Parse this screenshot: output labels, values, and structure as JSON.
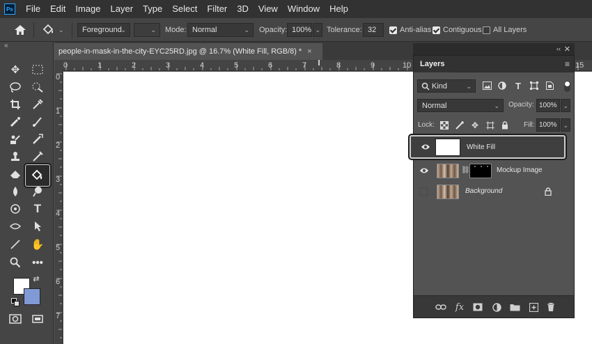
{
  "app": {
    "logo_text": "Ps"
  },
  "menu": [
    "File",
    "Edit",
    "Image",
    "Layer",
    "Type",
    "Select",
    "Filter",
    "3D",
    "View",
    "Window",
    "Help"
  ],
  "options_bar": {
    "fill_source": "Foreground",
    "mode_label": "Mode:",
    "mode_value": "Normal",
    "opacity_label": "Opacity:",
    "opacity_value": "100%",
    "tolerance_label": "Tolerance:",
    "tolerance_value": "32",
    "anti_alias_label": "Anti-alias",
    "anti_alias_checked": true,
    "contiguous_label": "Contiguous",
    "contiguous_checked": true,
    "all_layers_label": "All Layers",
    "all_layers_checked": false
  },
  "document": {
    "tab_title": "people-in-mask-in-the-city-EYC25RD.jpg @ 16.7% (White Fill, RGB/8) *",
    "close_glyph": "×",
    "ruler_top_labels": [
      "0",
      "1",
      "2",
      "3",
      "4",
      "5",
      "6",
      "7",
      "8",
      "9",
      "10",
      "15"
    ],
    "ruler_left_labels": [
      "0",
      "1",
      "2",
      "3",
      "4",
      "5",
      "6",
      "7"
    ]
  },
  "colors": {
    "foreground": "#ffffff",
    "background": "#7f9ad4"
  },
  "layers_panel": {
    "title": "Layers",
    "filter_kind": "Kind",
    "blend_mode": "Normal",
    "opacity_label": "Opacity:",
    "opacity_value": "100%",
    "lock_label": "Lock:",
    "fill_label": "Fill:",
    "fill_value": "100%",
    "layers": [
      {
        "name": "White Fill",
        "visible": true,
        "selected": true
      },
      {
        "name": "Mockup Image",
        "visible": true,
        "selected": false,
        "has_mask": true
      },
      {
        "name": "Background",
        "visible": false,
        "selected": false,
        "locked": true
      }
    ]
  }
}
